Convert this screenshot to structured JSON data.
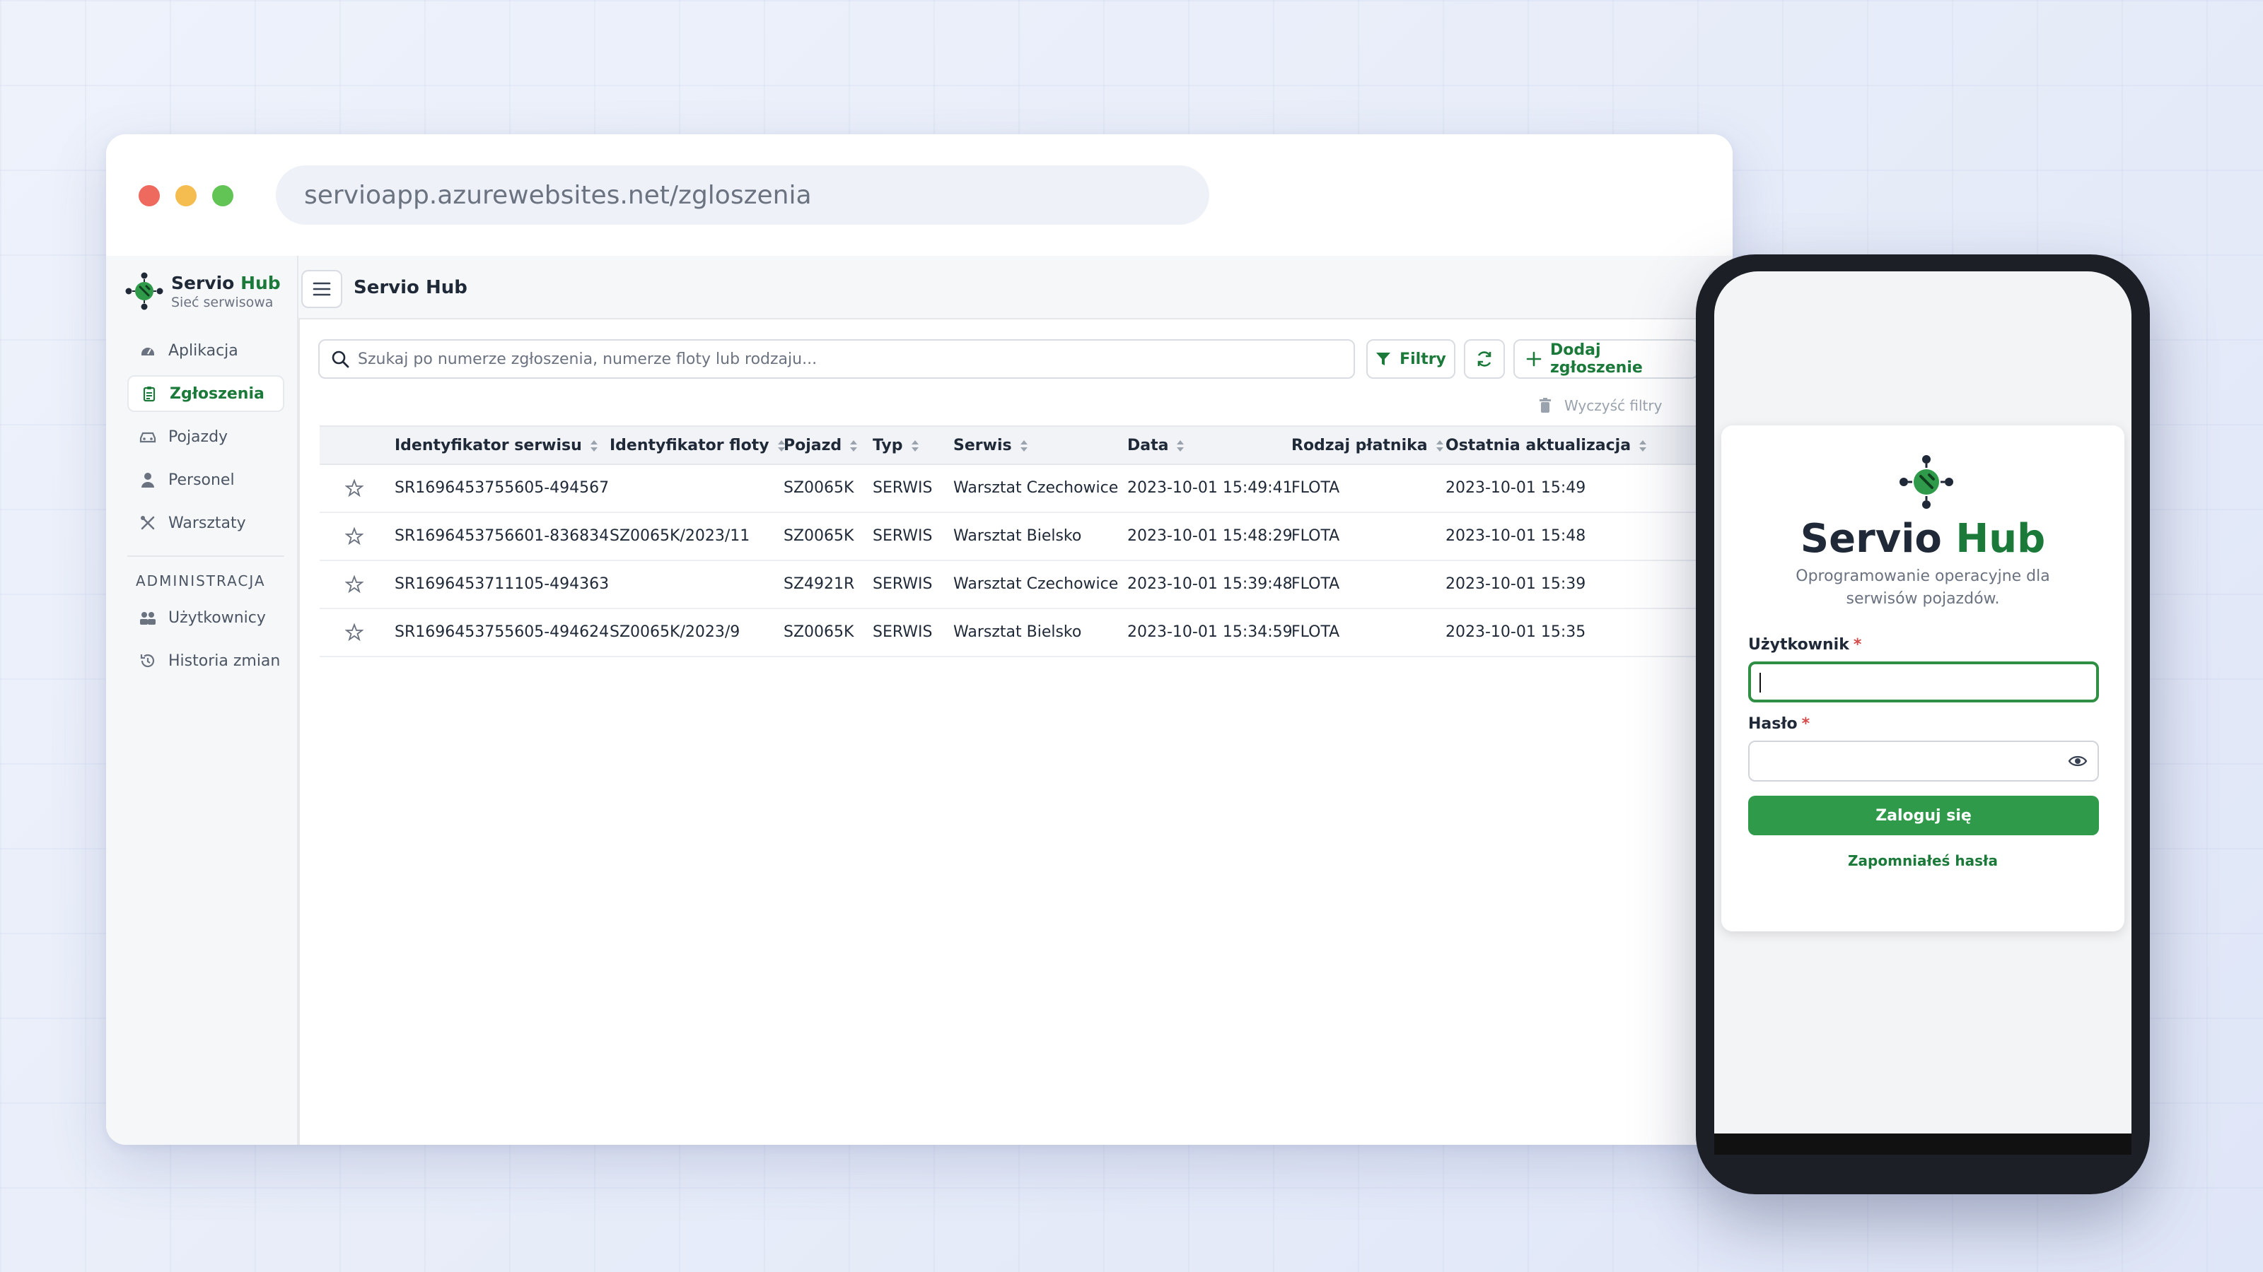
{
  "browser": {
    "url": "servioapp.azurewebsites.net/zgloszenia"
  },
  "brand": {
    "name_part1": "Servio",
    "name_part2": "Hub",
    "subtitle": "Sieć serwisowa",
    "accent": "#1b7a3a"
  },
  "sidebar": {
    "items": [
      {
        "label": "Aplikacja",
        "icon": "dashboard-icon"
      },
      {
        "label": "Zgłoszenia",
        "icon": "clipboard-icon",
        "active": true
      },
      {
        "label": "Pojazdy",
        "icon": "car-icon"
      },
      {
        "label": "Personel",
        "icon": "person-icon"
      },
      {
        "label": "Warsztaty",
        "icon": "tools-icon"
      }
    ],
    "section_label": "ADMINISTRACJA",
    "admin_items": [
      {
        "label": "Użytkownicy",
        "icon": "users-icon"
      },
      {
        "label": "Historia zmian",
        "icon": "history-icon"
      }
    ]
  },
  "topbar": {
    "title": "Servio Hub"
  },
  "toolbar": {
    "search_placeholder": "Szukaj po numerze zgłoszenia, numerze floty lub rodzaju...",
    "filters_label": "Filtry",
    "add_label": "Dodaj zgłoszenie",
    "clear_filters_label": "Wyczyść filtry"
  },
  "table": {
    "columns": [
      "Identyfikator serwisu",
      "Identyfikator floty",
      "Pojazd",
      "Typ",
      "Serwis",
      "Data",
      "Rodzaj płatnika",
      "Ostatnia aktualizacja"
    ],
    "rows": [
      [
        "SR1696453755605-494567",
        "",
        "SZ0065K",
        "SERWIS",
        "Warsztat Czechowice",
        "2023-10-01 15:49:41",
        "FLOTA",
        "2023-10-01 15:49"
      ],
      [
        "SR1696453756601-836834",
        "SZ0065K/2023/11",
        "SZ0065K",
        "SERWIS",
        "Warsztat Bielsko",
        "2023-10-01 15:48:29",
        "FLOTA",
        "2023-10-01 15:48"
      ],
      [
        "SR1696453711105-494363",
        "",
        "SZ4921R",
        "SERWIS",
        "Warsztat Czechowice",
        "2023-10-01 15:39:48",
        "FLOTA",
        "2023-10-01 15:39"
      ],
      [
        "SR1696453755605-494624",
        "SZ0065K/2023/9",
        "SZ0065K",
        "SERWIS",
        "Warsztat Bielsko",
        "2023-10-01 15:34:59",
        "FLOTA",
        "2023-10-01 15:35"
      ]
    ]
  },
  "login": {
    "title_part1": "Servio",
    "title_part2": "Hub",
    "subtitle": "Oprogramowanie operacyjne dla serwisów pojazdów.",
    "username_label": "Użytkownik",
    "password_label": "Hasło",
    "required_mark": "*",
    "submit_label": "Zaloguj się",
    "forgot_label": "Zapomniałeś hasła",
    "button_color": "#2e9a4a"
  }
}
